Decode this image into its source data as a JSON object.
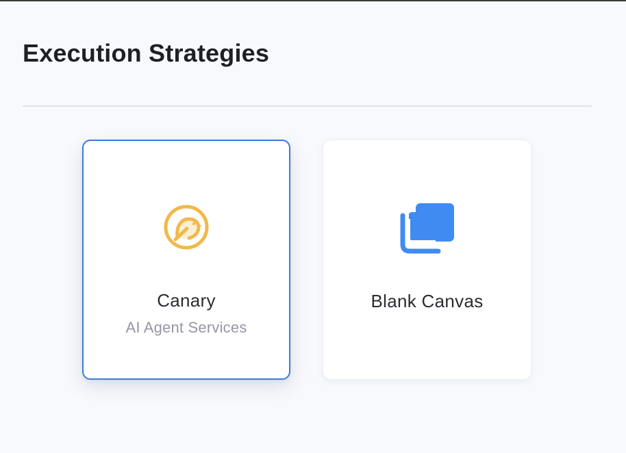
{
  "header": {
    "title": "Execution Strategies"
  },
  "strategies": [
    {
      "title": "Canary",
      "subtitle": "AI Agent Services",
      "icon": "canary-icon",
      "selected": true
    },
    {
      "title": "Blank Canvas",
      "subtitle": "",
      "icon": "blank-canvas-icon",
      "selected": false
    }
  ],
  "colors": {
    "background": "#f8f9fd",
    "selected_border": "#3d7ad6",
    "canary_icon": "#f2b84b",
    "canvas_icon": "#3f8bf2",
    "subtitle": "#9596a6"
  }
}
